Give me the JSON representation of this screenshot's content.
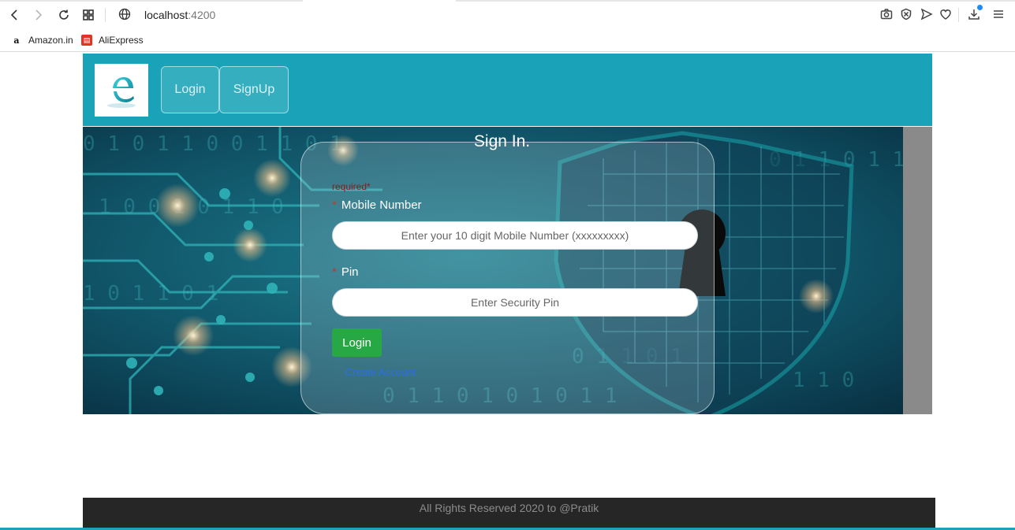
{
  "browser": {
    "url_host": "localhost",
    "url_port": ":4200",
    "bookmarks": [
      {
        "label": "Amazon.in",
        "icon": "amazon-icon"
      },
      {
        "label": "AliExpress",
        "icon": "aliexpress-icon"
      }
    ]
  },
  "header": {
    "logo_letter": "e",
    "nav": {
      "login": "Login",
      "signup": "SignUp"
    }
  },
  "form": {
    "title": "Sign In.",
    "required_note": "required*",
    "mobile": {
      "label": "Mobile Number",
      "placeholder": "Enter your 10 digit Mobile Number (xxxxxxxxx)"
    },
    "pin": {
      "label": "Pin",
      "placeholder": "Enter Security Pin"
    },
    "star": "*",
    "login_button": "Login",
    "create_account": "Create Account"
  },
  "footer": {
    "text": "All Rights Reserved 2020 to @Pratik"
  },
  "colors": {
    "header": "#1aa3b8",
    "login_button": "#28a745",
    "link": "#2b6fe6",
    "footer": "#262626"
  }
}
